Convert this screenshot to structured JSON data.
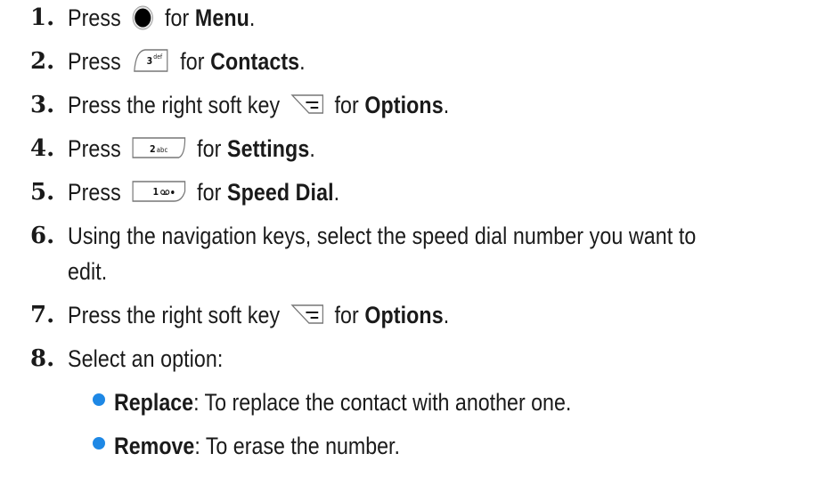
{
  "steps": [
    {
      "number": "1.",
      "pre": "Press",
      "key_icon": "menu-ok-key-icon",
      "mid": "for",
      "bold": "Menu",
      "post": "."
    },
    {
      "number": "2.",
      "pre": "Press",
      "key_icon": "key-3-def-icon",
      "mid": "for",
      "bold": "Contacts",
      "post": "."
    },
    {
      "number": "3.",
      "pre": "Press the right soft key",
      "key_icon": "right-soft-key-icon",
      "mid": "for",
      "bold": "Options",
      "post": "."
    },
    {
      "number": "4.",
      "pre": "Press",
      "key_icon": "key-2-abc-icon",
      "mid": "for",
      "bold": "Settings",
      "post": "."
    },
    {
      "number": "5.",
      "pre": "Press",
      "key_icon": "key-1-voicemail-icon",
      "mid": "for",
      "bold": "Speed Dial",
      "post": "."
    },
    {
      "number": "6.",
      "text_line1": "Using the navigation keys, select the speed dial number you want to",
      "text_line2": "edit."
    },
    {
      "number": "7.",
      "pre": "Press the right soft key",
      "key_icon": "right-soft-key-icon",
      "mid": "for",
      "bold": "Options",
      "post": "."
    },
    {
      "number": "8.",
      "text": "Select an option:"
    }
  ],
  "options": [
    {
      "label": "Replace",
      "desc": ": To replace the contact with another one."
    },
    {
      "label": "Remove",
      "desc": ": To erase the number."
    }
  ],
  "key_labels": {
    "key3": "3",
    "key3_letters": "def",
    "key2": "2",
    "key2_letters": "abc",
    "key1": "1",
    "key1_letters": "oo"
  },
  "colors": {
    "bullet": "#1e88e5",
    "text": "#1a1a1a"
  }
}
